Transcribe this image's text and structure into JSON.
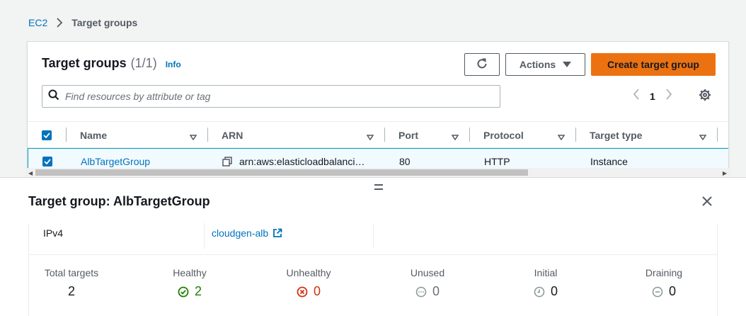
{
  "breadcrumb": {
    "root": "EC2",
    "current": "Target groups"
  },
  "panel": {
    "title": "Target groups",
    "count": "(1/1)",
    "info": "Info",
    "actions_label": "Actions",
    "create_label": "Create target group",
    "search_placeholder": "Find resources by attribute or tag",
    "page_number": "1"
  },
  "table": {
    "columns": [
      "Name",
      "ARN",
      "Port",
      "Protocol",
      "Target type"
    ],
    "rows": [
      {
        "name": "AlbTargetGroup",
        "arn": "arn:aws:elasticloadbalanci…",
        "port": "80",
        "protocol": "HTTP",
        "target_type": "Instance",
        "selected": true
      }
    ]
  },
  "details": {
    "title": "Target group: AlbTargetGroup",
    "ip_type": "IPv4",
    "load_balancer": "cloudgen-alb",
    "stats": [
      {
        "label": "Total targets",
        "value": "2",
        "status": "none"
      },
      {
        "label": "Healthy",
        "value": "2",
        "status": "healthy"
      },
      {
        "label": "Unhealthy",
        "value": "0",
        "status": "unhealthy"
      },
      {
        "label": "Unused",
        "value": "0",
        "status": "unused"
      },
      {
        "label": "Initial",
        "value": "0",
        "status": "initial"
      },
      {
        "label": "Draining",
        "value": "0",
        "status": "draining"
      }
    ]
  },
  "colors": {
    "link": "#0073bb",
    "primary_button": "#ec7211",
    "healthy": "#1d8102",
    "unhealthy": "#d13212",
    "neutral": "#879596"
  },
  "icons": [
    "chevron-right-icon",
    "refresh-icon",
    "caret-down-icon",
    "search-icon",
    "chevron-left-icon",
    "gear-icon",
    "sort-caret-icon",
    "copy-icon",
    "close-icon",
    "external-link-icon",
    "drag-handle-icon",
    "check-circle-icon",
    "x-circle-icon",
    "ellipsis-circle-icon",
    "clock-icon",
    "minus-circle-icon"
  ]
}
